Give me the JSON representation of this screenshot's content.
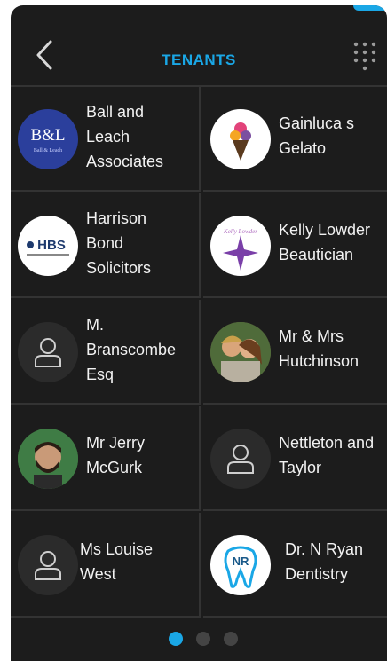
{
  "header": {
    "title": "TENANTS"
  },
  "tenants": [
    {
      "name": "Ball and\nLeach\nAssociates",
      "logo_text": "B&L",
      "logo_sub": "Ball & Leach",
      "lines": 3
    },
    {
      "name": "Gainluca s\nGelato",
      "lines": 2
    },
    {
      "name": "Harrison\nBond\nSolicitors",
      "logo_text": "HBS",
      "lines": 3
    },
    {
      "name": "Kelly Lowder\nBeautician",
      "logo_text": "Kelly Lowder",
      "lines": 2
    },
    {
      "name": "M.\nBranscombe\nEsq",
      "lines": 3
    },
    {
      "name": "Mr & Mrs\nHutchinson",
      "lines": 2
    },
    {
      "name": "Mr Jerry\nMcGurk",
      "lines": 2
    },
    {
      "name": "Nettleton and\nTaylor",
      "lines": 2
    },
    {
      "name": "Ms Louise\nWest",
      "lines": 2
    },
    {
      "name": "Dr. N Ryan\nDentistry",
      "logo_text": "NR",
      "lines": 2
    }
  ],
  "pagination": {
    "pages": 3,
    "current": 1
  },
  "colors": {
    "accent": "#1aa7e6",
    "background": "#1c1c1c",
    "divider": "#333333"
  }
}
